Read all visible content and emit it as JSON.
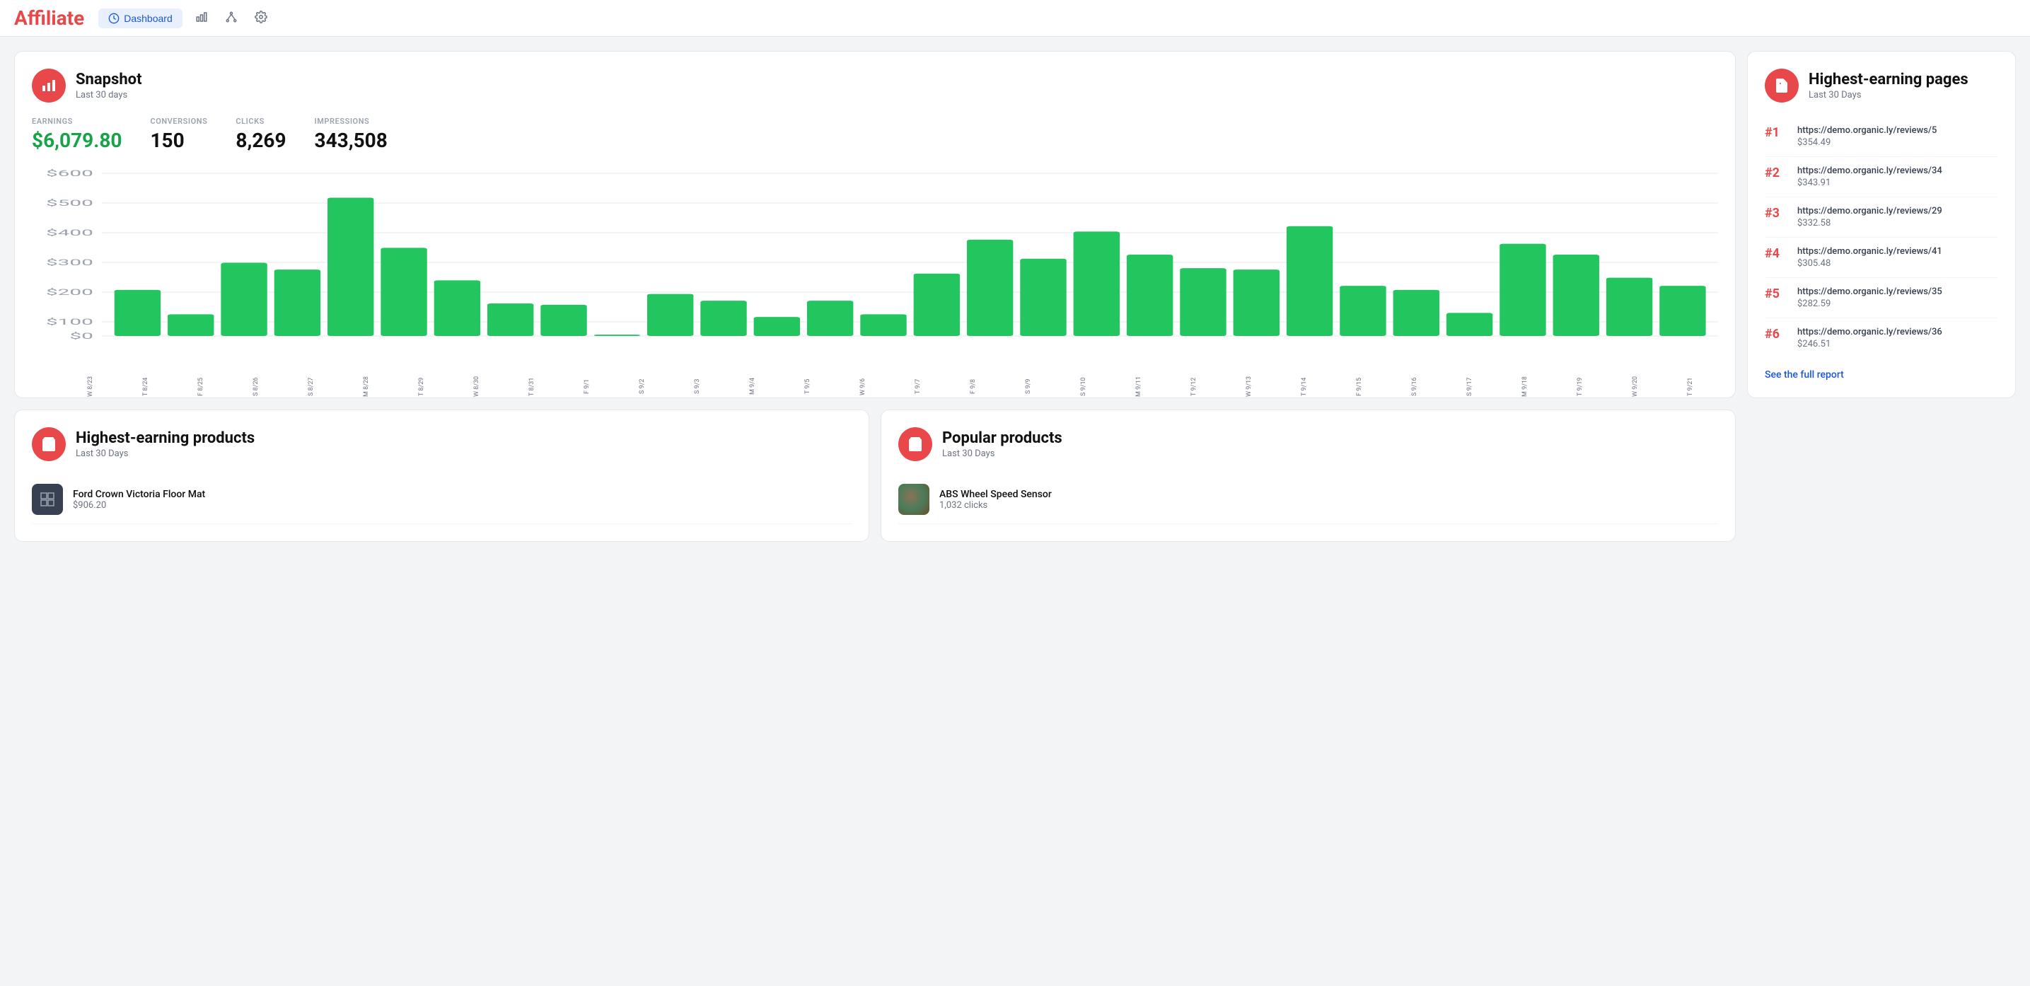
{
  "header": {
    "title": "Affiliate",
    "nav": [
      {
        "label": "Dashboard",
        "icon": "dashboard",
        "active": true
      },
      {
        "label": "stats",
        "icon": "bar-chart",
        "active": false
      },
      {
        "label": "network",
        "icon": "network",
        "active": false
      },
      {
        "label": "settings",
        "icon": "gear",
        "active": false
      }
    ]
  },
  "snapshot": {
    "title": "Snapshot",
    "subtitle": "Last 30 days",
    "stats": {
      "earnings_label": "EARNINGS",
      "earnings_value": "$6,079.80",
      "conversions_label": "CONVERSIONS",
      "conversions_value": "150",
      "clicks_label": "CLICKS",
      "clicks_value": "8,269",
      "impressions_label": "IMPRESSIONS",
      "impressions_value": "343,508"
    },
    "chart": {
      "y_labels": [
        "$600",
        "$500",
        "$400",
        "$300",
        "$200",
        "$100",
        "$0"
      ],
      "bars": [
        {
          "label": "W 8/23",
          "value": 170
        },
        {
          "label": "T 8/24",
          "value": 80
        },
        {
          "label": "F 8/25",
          "value": 270
        },
        {
          "label": "S 8/26",
          "value": 245
        },
        {
          "label": "S 8/27",
          "value": 510
        },
        {
          "label": "M 8/28",
          "value": 325
        },
        {
          "label": "T 8/29",
          "value": 205
        },
        {
          "label": "W 8/30",
          "value": 120
        },
        {
          "label": "T 8/31",
          "value": 115
        },
        {
          "label": "F 9/1",
          "value": 5
        },
        {
          "label": "S 9/2",
          "value": 155
        },
        {
          "label": "S 9/3",
          "value": 130
        },
        {
          "label": "M 9/4",
          "value": 70
        },
        {
          "label": "T 9/5",
          "value": 130
        },
        {
          "label": "W 9/6",
          "value": 80
        },
        {
          "label": "T 9/7",
          "value": 230
        },
        {
          "label": "F 9/8",
          "value": 355
        },
        {
          "label": "S 9/9",
          "value": 285
        },
        {
          "label": "S 9/10",
          "value": 385
        },
        {
          "label": "M 9/11",
          "value": 300
        },
        {
          "label": "T 9/12",
          "value": 250
        },
        {
          "label": "W 9/13",
          "value": 245
        },
        {
          "label": "T 9/14",
          "value": 405
        },
        {
          "label": "F 9/15",
          "value": 185
        },
        {
          "label": "S 9/16",
          "value": 170
        },
        {
          "label": "S 9/17",
          "value": 85
        },
        {
          "label": "M 9/18",
          "value": 340
        },
        {
          "label": "T 9/19",
          "value": 300
        },
        {
          "label": "W 9/20",
          "value": 215
        },
        {
          "label": "T 9/21",
          "value": 185
        }
      ]
    }
  },
  "highest_earning_pages": {
    "title": "Highest-earning pages",
    "subtitle": "Last 30 Days",
    "pages": [
      {
        "rank": "#1",
        "url": "https://demo.organic.ly/reviews/5",
        "earnings": "$354.49"
      },
      {
        "rank": "#2",
        "url": "https://demo.organic.ly/reviews/34",
        "earnings": "$343.91"
      },
      {
        "rank": "#3",
        "url": "https://demo.organic.ly/reviews/29",
        "earnings": "$332.58"
      },
      {
        "rank": "#4",
        "url": "https://demo.organic.ly/reviews/41",
        "earnings": "$305.48"
      },
      {
        "rank": "#5",
        "url": "https://demo.organic.ly/reviews/35",
        "earnings": "$282.59"
      },
      {
        "rank": "#6",
        "url": "https://demo.organic.ly/reviews/36",
        "earnings": "$246.51"
      }
    ],
    "see_full_report": "See the full report"
  },
  "highest_earning_products": {
    "title": "Highest-earning products",
    "subtitle": "Last 30 Days",
    "products": [
      {
        "name": "Ford Crown Victoria Floor Mat",
        "value": "$906.20"
      }
    ]
  },
  "popular_products": {
    "title": "Popular products",
    "subtitle": "Last 30 Days",
    "products": [
      {
        "name": "ABS Wheel Speed Sensor",
        "value": "1,032 clicks"
      }
    ]
  }
}
